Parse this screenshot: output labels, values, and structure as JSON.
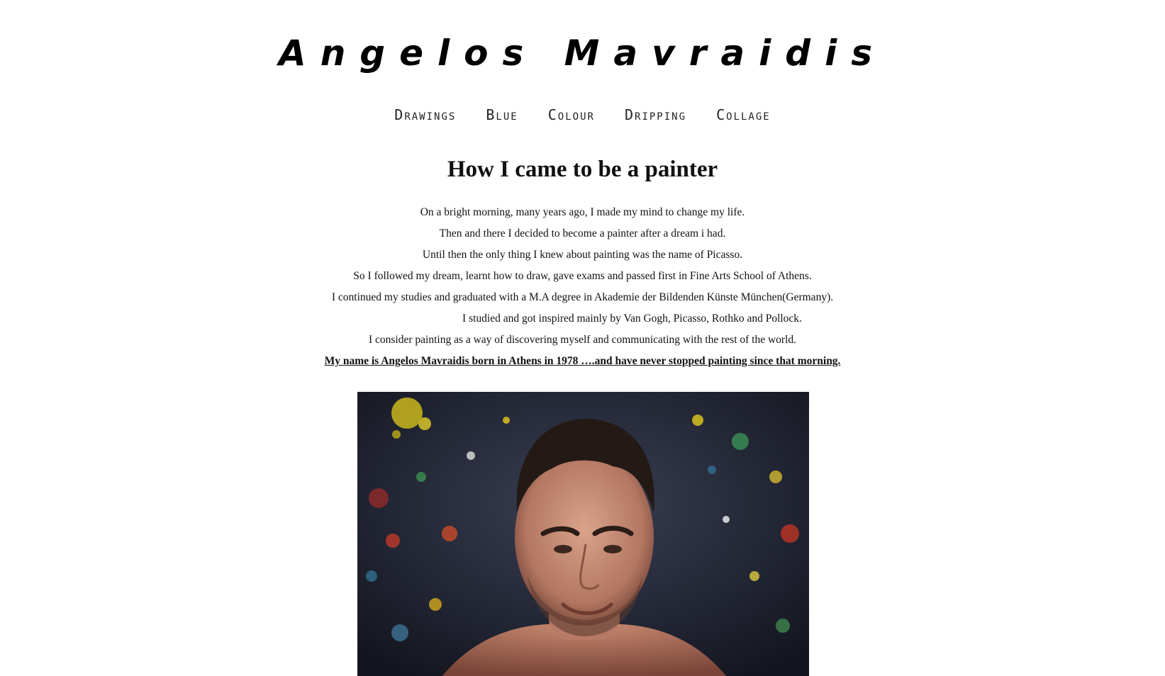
{
  "site": {
    "title": "Angelos Mavraidis"
  },
  "nav": {
    "items": [
      {
        "label": "Drawings"
      },
      {
        "label": "Blue"
      },
      {
        "label": "Colour"
      },
      {
        "label": "Dripping"
      },
      {
        "label": "Collage"
      }
    ]
  },
  "main": {
    "title": "How I came to be a painter",
    "paragraphs": [
      "On a bright morning, many years ago, I made my mind to change my life.",
      "Then and there I decided to become a painter after a dream i had.",
      "Until then the only thing I knew about painting was the name of Picasso.",
      "So I followed my dream, learnt how to draw, gave exams and passed first in Fine Arts School of Athens.",
      "I continued my studies and graduated with a M.A degree in Akademie der Bildenden Künste München(Germany).",
      "I studied and got inspired mainly by Van Gogh, Picasso, Rothko and Pollock.",
      "I consider painting as a way of discovering myself and communicating with the rest of the world.",
      "My name is Angelos Mavraidis born in Athens in 1978 ….and have never stopped painting since that morning."
    ]
  },
  "portrait": {
    "icon": "portrait-photo"
  }
}
